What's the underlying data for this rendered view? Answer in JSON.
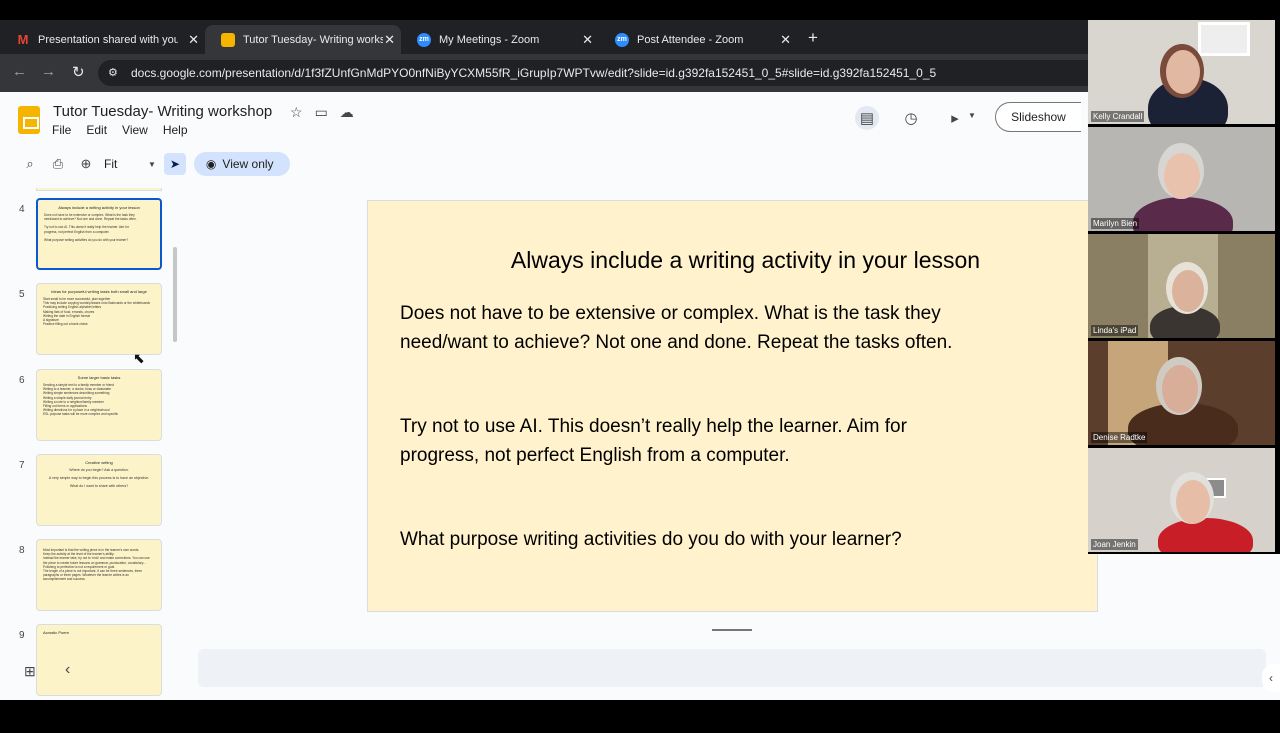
{
  "browser": {
    "tabs": [
      {
        "title": "Presentation shared with you: \"",
        "icon": "gmail-icon"
      },
      {
        "title": "Tutor Tuesday- Writing worksh",
        "icon": "slides-icon",
        "active": true
      },
      {
        "title": "My Meetings - Zoom",
        "icon": "zoom-icon"
      },
      {
        "title": "Post Attendee - Zoom",
        "icon": "zoom-icon"
      }
    ],
    "url": "docs.google.com/presentation/d/1f3fZUnfGnMdPYO0nfNiByYCXM55fR_iGrupIp7WPTvw/edit?slide=id.g392fa152451_0_5#slide=id.g392fa152451_0_5"
  },
  "docs": {
    "title": "Tutor Tuesday- Writing workshop",
    "menu": [
      "File",
      "Edit",
      "View",
      "Help"
    ],
    "zoom": "Fit",
    "view_only": "View only",
    "slideshow": "Slideshow"
  },
  "filmstrip": [
    {
      "num": "4",
      "selected": true,
      "title": "Always include a writing activity in your lesson",
      "lines": [
        "Does not have to be extensive or complex. What is the task they",
        "need/want to achieve? Not one and done. Repeat the tasks often.",
        "",
        "Try not to use AI. This doesn't really help the learner. Aim for",
        "progress, not perfect English from a computer.",
        "",
        "What purpose writing activities do you do with your learner?"
      ]
    },
    {
      "num": "5",
      "selected": false,
      "title": "Ideas for purposeful writing tasks both small and large",
      "lines": [
        "Start small to be more successful, plan together",
        "This may include copying words/phrases onto flashcards or the whiteboards",
        "Practicing writing English alphabet letters",
        "Making lists of food, errands, chores",
        "Writing the date in English format",
        "A signature",
        "Practice filling out a bank check"
      ]
    },
    {
      "num": "6",
      "selected": false,
      "title": "Some larger basic tasks",
      "lines": [
        "Sending a simple text to a family member or friend",
        "Writing to a teacher, a doctor, boss or classmate",
        "Writing simple sentences describing something",
        "Writing a simple daily journal entry",
        "Writing a note to a neighbor/family member",
        "Filling out forms or applications",
        "Writing directions for a place in a neighborhood",
        "ESL purpose tasks will be more complex and specific"
      ]
    },
    {
      "num": "7",
      "selected": false,
      "title": "Creative writing",
      "lines": [
        "Where do you begin? Ask a question.",
        "",
        "A very simple way to begin this process is to have an objective.",
        "",
        "What do I want to share with others?"
      ]
    },
    {
      "num": "8",
      "selected": false,
      "title": "",
      "lines": [
        "Most important is that the writing piece is in the learner's own words.",
        "Keep the activity at the level of the learner's ability.",
        "Instead the learner take, try not to 'redo' and make corrections. You can use",
        "the piece to create future lessons on grammar, punctuation, vocabulary...",
        "Polishing to perfection is not a requirement or goal.",
        "The length of a piece is not important. It can be three sentences, three",
        "paragraphs or three pages. Whatever the learner writes is an",
        "accomplishment and success."
      ]
    },
    {
      "num": "9",
      "selected": false,
      "title": "Acrostic Poem",
      "lines": []
    }
  ],
  "slide": {
    "title": "Always include a writing activity in your lesson",
    "p1": [
      "Does not have to be extensive or complex. What is the task they",
      "need/want to achieve?  Not one and done. Repeat the tasks often."
    ],
    "p2": [
      "Try not to use AI. This doesn’t really help the learner.  Aim for",
      "progress, not perfect English from a computer."
    ],
    "p3": "What purpose writing activities do you do with your learner?"
  },
  "participants": [
    {
      "name": "Kelly Crandall"
    },
    {
      "name": "Marilyn Bien"
    },
    {
      "name": "Linda's iPad"
    },
    {
      "name": "Denise Radtke"
    },
    {
      "name": "Joan Jenkin"
    }
  ]
}
